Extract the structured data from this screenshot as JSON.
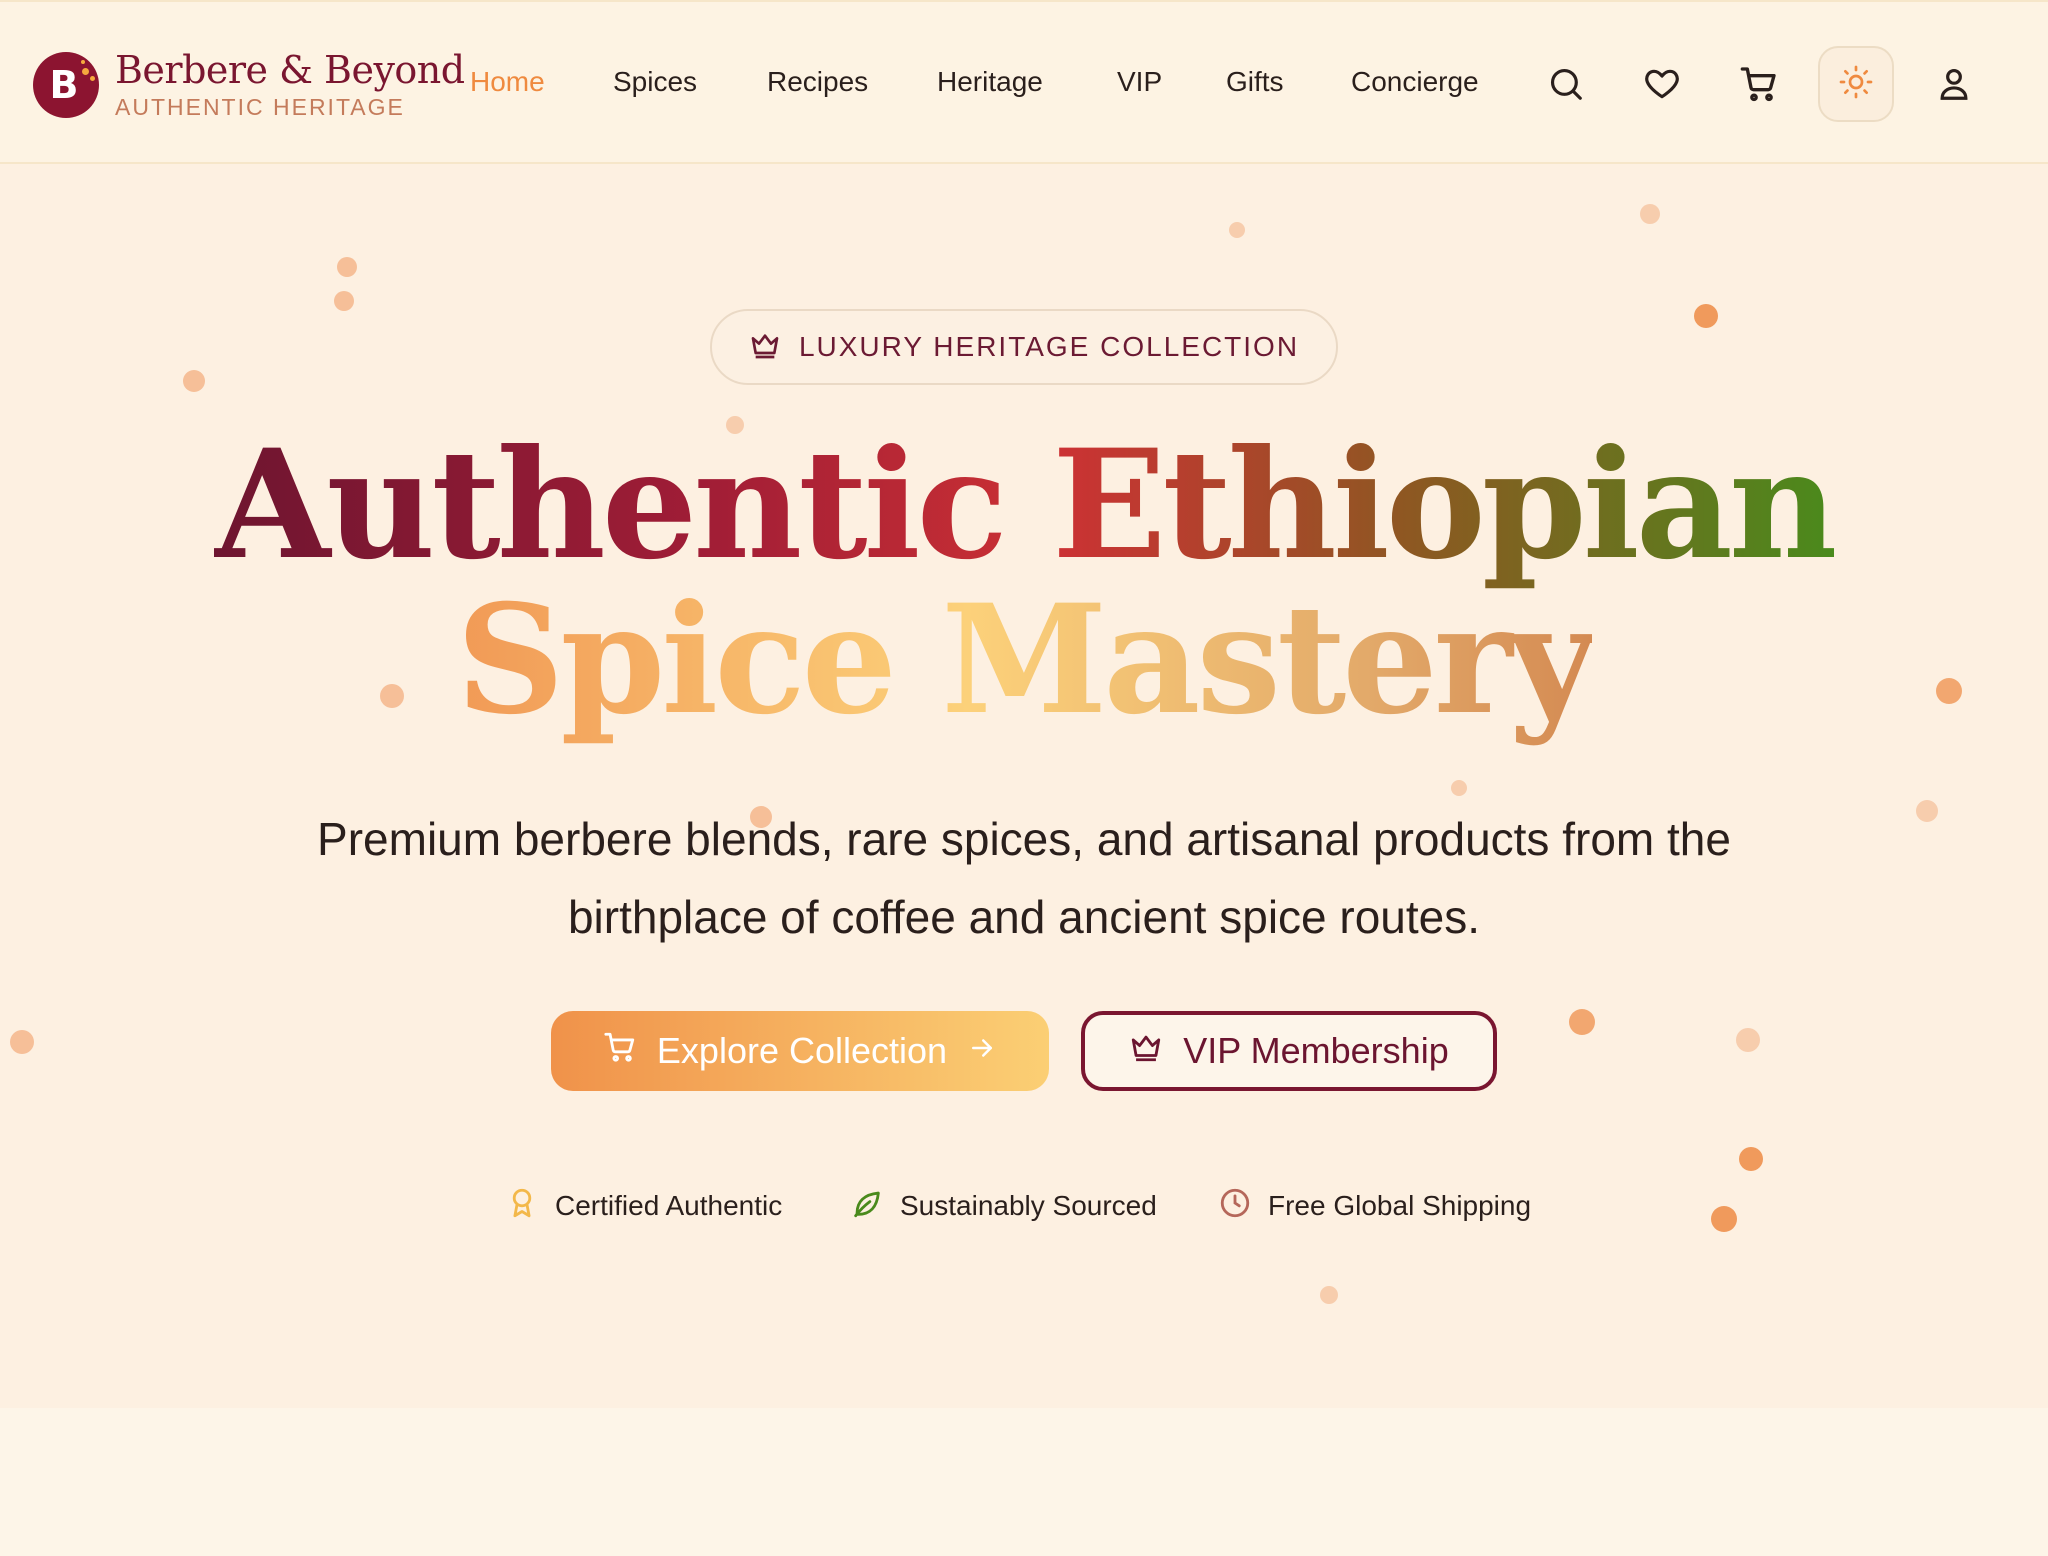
{
  "brand": {
    "logo_letter": "B",
    "name": "Berbere & Beyond",
    "tagline": "AUTHENTIC HERITAGE"
  },
  "nav": {
    "items": [
      {
        "label": "Home",
        "active": true
      },
      {
        "label": "Spices",
        "active": false
      },
      {
        "label": "Recipes",
        "active": false
      },
      {
        "label": "Heritage",
        "active": false
      },
      {
        "label": "VIP",
        "active": false
      },
      {
        "label": "Gifts",
        "active": false
      },
      {
        "label": "Concierge",
        "active": false
      }
    ],
    "icons": [
      "search-icon",
      "heart-icon",
      "cart-icon",
      "sun-icon",
      "user-icon"
    ]
  },
  "hero": {
    "badge": "LUXURY HERITAGE COLLECTION",
    "headline_line1": "Authentic Ethiopian",
    "headline_line2": "Spice Mastery",
    "subtitle": "Premium berbere blends, rare spices, and artisanal products from the birthplace of coffee and ancient spice routes.",
    "primary_cta": "Explore Collection",
    "secondary_cta": "VIP Membership",
    "features": [
      {
        "icon": "award-icon",
        "label": "Certified Authentic"
      },
      {
        "icon": "leaf-icon",
        "label": "Sustainably Sourced"
      },
      {
        "icon": "clock-icon",
        "label": "Free Global Shipping"
      }
    ]
  },
  "colors": {
    "accent": "#ef8a3f",
    "brand": "#8c1430",
    "background": "#fdf0e1"
  }
}
